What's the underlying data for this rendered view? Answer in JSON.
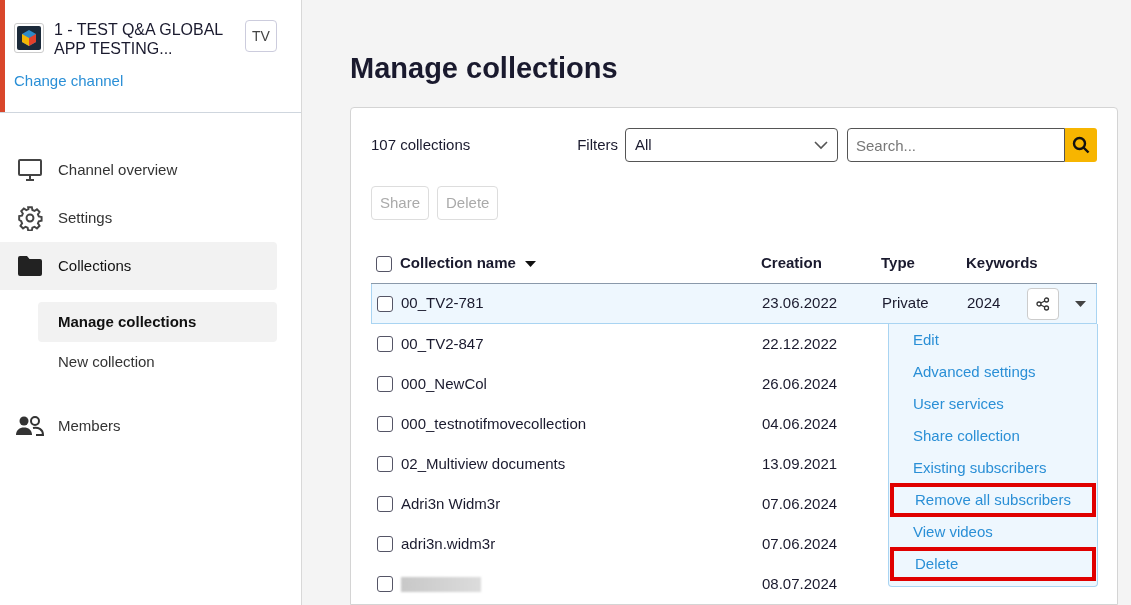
{
  "channel": {
    "name": "1 - TEST Q&A GLOBAL APP TESTING...",
    "badge": "TV",
    "change_link": "Change channel"
  },
  "nav": [
    {
      "label": "Channel overview",
      "selected": false
    },
    {
      "label": "Settings",
      "selected": false
    },
    {
      "label": "Collections",
      "selected": true,
      "children": [
        {
          "label": "Manage collections",
          "selected": true
        },
        {
          "label": "New collection",
          "selected": false
        }
      ]
    },
    {
      "label": "Members",
      "selected": false
    }
  ],
  "page_title": "Manage collections",
  "toolbar": {
    "count": "107  collections",
    "filters_label": "Filters",
    "filter_value": "All",
    "search_placeholder": "Search..."
  },
  "bulk_actions": [
    {
      "label": "Share",
      "disabled": true
    },
    {
      "label": "Delete",
      "disabled": true
    }
  ],
  "table": {
    "columns": [
      "Collection name",
      "Creation",
      "Type",
      "Keywords"
    ],
    "all_checked": false,
    "rows": [
      {
        "name": "00_TV2-781",
        "creation": "23.06.2022",
        "type": "Private",
        "keywords": "2024",
        "selected": true,
        "checked": false
      },
      {
        "name": "00_TV2-847",
        "creation": "22.12.2022",
        "selected": false,
        "checked": false
      },
      {
        "name": "000_NewCol",
        "creation": "26.06.2024",
        "selected": false,
        "checked": false
      },
      {
        "name": "000_testnotifmovecollection",
        "creation": "04.06.2024",
        "selected": false,
        "checked": false
      },
      {
        "name": "02_Multiview documents",
        "creation": "13.09.2021",
        "selected": false,
        "checked": false
      },
      {
        "name": "Adri3n Widm3r",
        "creation": "07.06.2024",
        "selected": false,
        "checked": false
      },
      {
        "name": "adri3n.widm3r",
        "creation": "07.06.2024",
        "selected": false,
        "checked": false
      },
      {
        "kind": "blurred",
        "creation": "08.07.2024",
        "selected": false,
        "checked": false
      }
    ]
  },
  "row_menu": [
    {
      "label": "Edit",
      "highlighted": false
    },
    {
      "label": "Advanced settings",
      "highlighted": false
    },
    {
      "label": "User services",
      "highlighted": false
    },
    {
      "label": "Share collection",
      "highlighted": false
    },
    {
      "label": "Existing subscribers",
      "highlighted": false
    },
    {
      "label": "Remove all subscribers",
      "highlighted": true
    },
    {
      "label": "View videos",
      "highlighted": false
    },
    {
      "label": "Delete",
      "highlighted": true
    }
  ]
}
